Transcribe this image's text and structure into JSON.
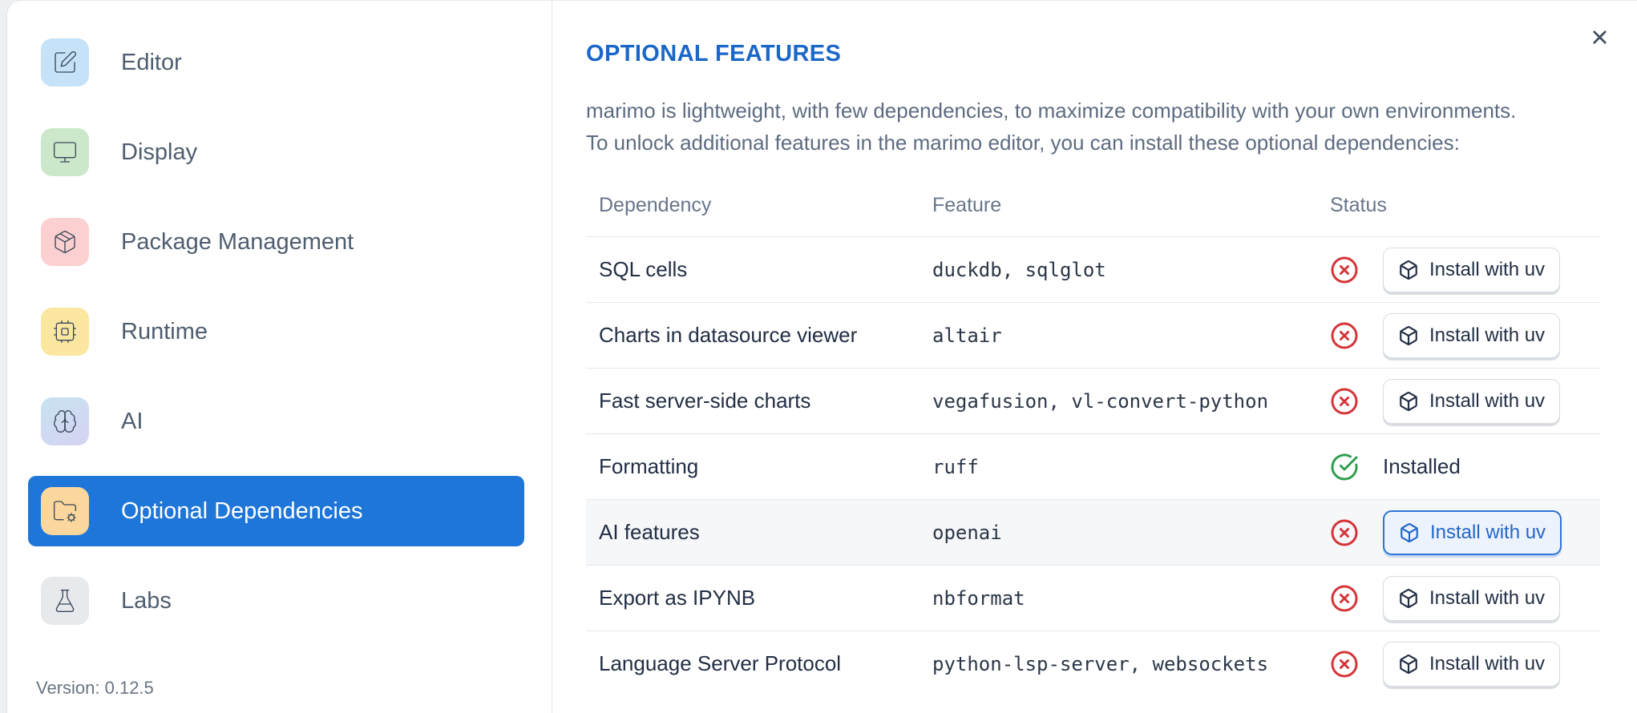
{
  "sidebar": {
    "items": [
      {
        "label": "Editor",
        "icon": "square-pen-icon"
      },
      {
        "label": "Display",
        "icon": "monitor-icon"
      },
      {
        "label": "Package Management",
        "icon": "package-icon"
      },
      {
        "label": "Runtime",
        "icon": "cpu-icon"
      },
      {
        "label": "AI",
        "icon": "brain-icon"
      },
      {
        "label": "Optional Dependencies",
        "icon": "folder-cog-icon",
        "selected": true
      },
      {
        "label": "Labs",
        "icon": "flask-icon"
      }
    ],
    "version_label": "Version: 0.12.5"
  },
  "panel": {
    "title": "OPTIONAL FEATURES",
    "description_line1": "marimo is lightweight, with few dependencies, to maximize compatibility with your own environments.",
    "description_line2": "To unlock additional features in the marimo editor, you can install these optional dependencies:",
    "close_icon": "close-icon"
  },
  "table": {
    "columns": [
      "Dependency",
      "Feature",
      "Status"
    ],
    "rows": [
      {
        "dependency": "SQL cells",
        "feature": "duckdb, sqlglot",
        "status": "not-installed",
        "action": "Install with uv"
      },
      {
        "dependency": "Charts in datasource viewer",
        "feature": "altair",
        "status": "not-installed",
        "action": "Install with uv"
      },
      {
        "dependency": "Fast server-side charts",
        "feature": "vegafusion, vl-convert-python",
        "status": "not-installed",
        "action": "Install with uv"
      },
      {
        "dependency": "Formatting",
        "feature": "ruff",
        "status": "installed",
        "status_label": "Installed"
      },
      {
        "dependency": "AI features",
        "feature": "openai",
        "status": "not-installed",
        "action": "Install with uv",
        "highlighted": true
      },
      {
        "dependency": "Export as IPYNB",
        "feature": "nbformat",
        "status": "not-installed",
        "action": "Install with uv"
      },
      {
        "dependency": "Language Server Protocol",
        "feature": "python-lsp-server, websockets",
        "status": "not-installed",
        "action": "Install with uv"
      }
    ]
  },
  "colors": {
    "selected_item_bg": "#1f76d9",
    "panel_title": "#1a67c9",
    "status_error": "#d53438",
    "status_ok": "#2f9e4f",
    "accent_button_border": "#2e74d5",
    "accent_button_bg": "#edf3fc"
  }
}
